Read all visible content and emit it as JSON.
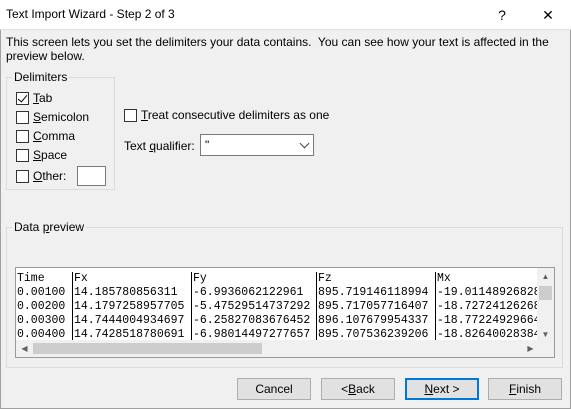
{
  "window": {
    "title": "Text Import Wizard - Step 2 of 3",
    "help_glyph": "?",
    "close_glyph": "✕"
  },
  "intro": "This screen lets you set the delimiters your data contains.  You can see how your text is affected in the preview below.",
  "delimiters": {
    "legend": "Delimiters",
    "tab": {
      "pre": "",
      "key": "T",
      "post": "ab",
      "checked": true
    },
    "semicolon": {
      "pre": "",
      "key": "S",
      "post": "emicolon",
      "checked": false
    },
    "comma": {
      "pre": "",
      "key": "C",
      "post": "omma",
      "checked": false
    },
    "space": {
      "pre": "",
      "key": "S",
      "post": "pace",
      "checked": false
    },
    "other": {
      "pre": "",
      "key": "O",
      "post": "ther:",
      "checked": false,
      "value": ""
    }
  },
  "consecutive": {
    "pre": "",
    "key": "T",
    "post": "reat consecutive delimiters as one",
    "checked": false
  },
  "qualifier": {
    "label_pre": "Text ",
    "label_key": "q",
    "label_post": "ualifier:",
    "value": "\""
  },
  "preview": {
    "legend_pre": "Data ",
    "legend_key": "p",
    "legend_post": "review",
    "columns": [
      "Time",
      "Fx",
      "Fy",
      "Fz",
      "Mx"
    ],
    "rows": [
      [
        "0.00100",
        "14.185780856311",
        "-6.9936062122961",
        "895.719146118994",
        "-19.01148926828"
      ],
      [
        "0.00200",
        "14.1797258957705",
        "-5.47529514737292",
        "895.717057716407",
        "-18.72724126268"
      ],
      [
        "0.00300",
        "14.7444004934697",
        "-6.25827083676452",
        "896.107679954337",
        "-18.77224929664"
      ],
      [
        "0.00400",
        "14.7428518780691",
        "-6.98014497277657",
        "895.707536239206",
        "-18.82640028384"
      ]
    ]
  },
  "buttons": {
    "cancel": {
      "pre": "Cancel",
      "key": "",
      "post": ""
    },
    "back": {
      "pre": "< ",
      "key": "B",
      "post": "ack"
    },
    "next": {
      "pre": "",
      "key": "N",
      "post": "ext >"
    },
    "finish": {
      "pre": "",
      "key": "F",
      "post": "inish"
    }
  },
  "colors": {
    "accent": "#0078d7",
    "face": "#f0f0f0"
  }
}
